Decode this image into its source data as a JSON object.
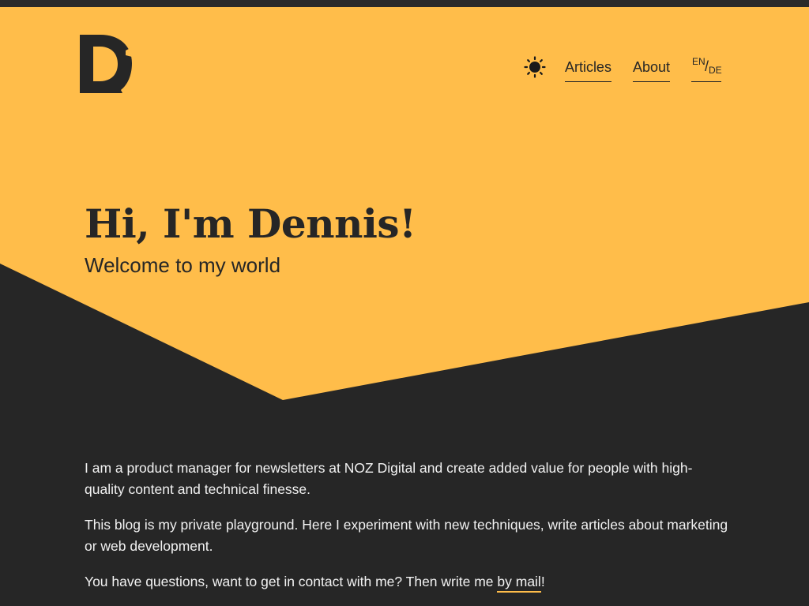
{
  "colors": {
    "accent": "#ffbd4a",
    "dark": "#262626",
    "text_light": "#f2f2f2"
  },
  "header": {
    "logo_icon": "letter-d-logo",
    "theme_toggle_icon": "sun-icon",
    "nav": [
      {
        "label": "Articles"
      },
      {
        "label": "About"
      }
    ],
    "language": {
      "current": "EN",
      "separator": "/",
      "other": "DE"
    }
  },
  "hero": {
    "title": "Hi, I'm Dennis!",
    "subtitle": "Welcome to my world"
  },
  "intro": {
    "p1": "I am a product manager for newsletters at NOZ Digital and create added value for people with high-quality content and technical finesse.",
    "p2": "This blog is my private playground. Here I experiment with new techniques, write articles about marketing or web development.",
    "p3_prefix": "You have questions, want to get in contact with me? Then write me ",
    "p3_link": "by mail",
    "p3_suffix": "!"
  }
}
